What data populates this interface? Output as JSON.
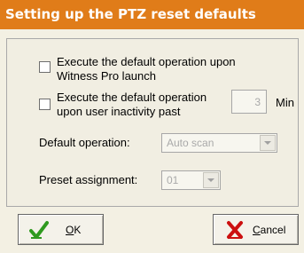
{
  "window": {
    "title": "Setting up the PTZ reset defaults"
  },
  "options": {
    "launch_line1": "Execute the default operation upon",
    "launch_line2": "Witness Pro launch",
    "inactivity_line1": "Execute the default operation",
    "inactivity_line2": "upon user inactivity past",
    "inactivity_minutes": "3",
    "minutes_unit": "Min"
  },
  "default_operation": {
    "label": "Default operation:",
    "value": "Auto scan"
  },
  "preset_assignment": {
    "label": "Preset assignment:",
    "value": "01"
  },
  "buttons": {
    "ok_mnemonic": "O",
    "ok_rest": "K",
    "cancel_mnemonic": "C",
    "cancel_rest": "ancel"
  },
  "colors": {
    "titlebar": "#e07c19",
    "check": "#2f9a1f",
    "cancel_x": "#cc1010"
  }
}
